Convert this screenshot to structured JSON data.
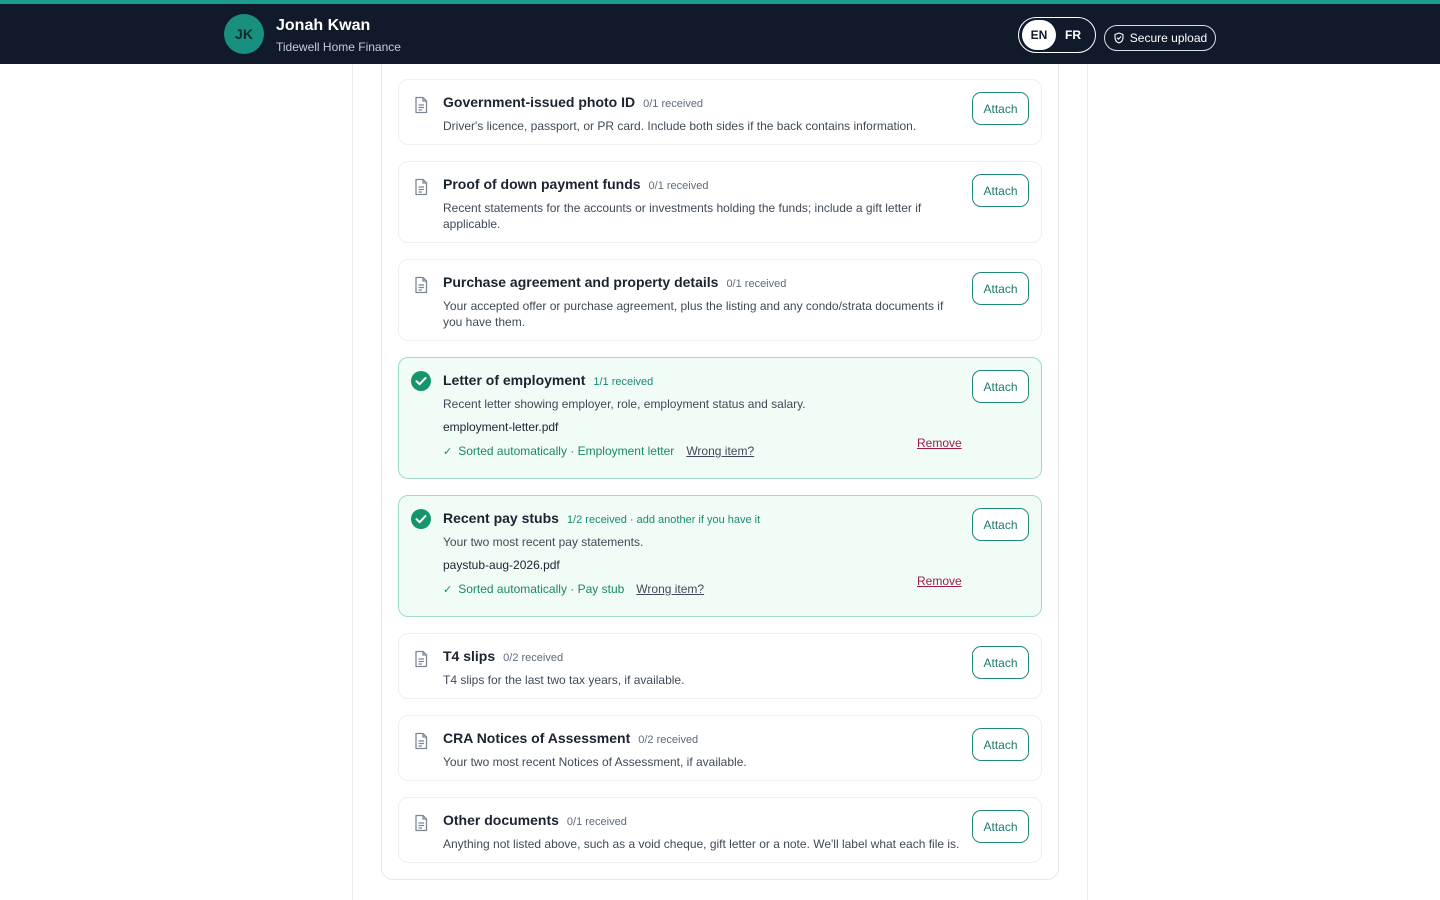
{
  "header": {
    "avatar_initials": "JK",
    "client_name": "Jonah Kwan",
    "firm_name": "Tidewell Home Finance",
    "languages": [
      {
        "code": "EN",
        "active": true
      },
      {
        "code": "FR",
        "active": false
      }
    ],
    "secure_upload_label": "Secure upload"
  },
  "colors": {
    "header_bg": "#111a2b",
    "accent_teal": "#1a9d8c",
    "received_green": "#1a8a5e",
    "remove_red": "#9b1e4a"
  },
  "requirements": [
    {
      "title": "Government-issued photo ID",
      "count": "0/1 received",
      "description": "Driver's licence, passport, or PR card. Include both sides if the back contains information.",
      "attach_label": "Attach",
      "icon": "document-icon"
    },
    {
      "title": "Proof of down payment funds",
      "count": "0/1 received",
      "description": "Recent statements for the accounts or investments holding the funds; include a gift letter if applicable.",
      "attach_label": "Attach",
      "icon": "document-icon"
    },
    {
      "title": "Purchase agreement and property details",
      "count": "0/1 received",
      "description": "Your accepted offer or purchase agreement, plus the listing and any condo/strata documents if you have them.",
      "attach_label": "Attach",
      "icon": "document-icon"
    },
    {
      "title": "Letter of employment",
      "count": "1/1 received",
      "description": "Recent letter showing employer, role, employment status and salary.",
      "attach_label": "Attach",
      "icon": "check-circle-icon",
      "file": {
        "name": "employment-letter.pdf",
        "sorted_text": "Sorted automatically · Employment letter",
        "wrong_item_label": "Wrong item?",
        "remove_label": "Remove"
      }
    },
    {
      "title": "Recent pay stubs",
      "count": "1/2 received · add another if you have it",
      "description": "Your two most recent pay statements.",
      "attach_label": "Attach",
      "icon": "check-circle-icon",
      "file": {
        "name": "paystub-aug-2026.pdf",
        "sorted_text": "Sorted automatically · Pay stub",
        "wrong_item_label": "Wrong item?",
        "remove_label": "Remove"
      }
    },
    {
      "title": "T4 slips",
      "count": "0/2 received",
      "description": "T4 slips for the last two tax years, if available.",
      "attach_label": "Attach",
      "icon": "document-icon"
    },
    {
      "title": "CRA Notices of Assessment",
      "count": "0/2 received",
      "description": "Your two most recent Notices of Assessment, if available.",
      "attach_label": "Attach",
      "icon": "document-icon"
    },
    {
      "title": "Other documents",
      "count": "0/1 received",
      "description": "Anything not listed above, such as a void cheque, gift letter or a note. We'll label what each file is.",
      "attach_label": "Attach",
      "icon": "document-icon"
    }
  ]
}
